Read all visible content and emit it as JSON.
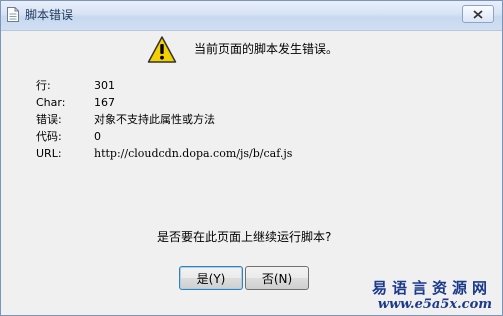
{
  "window": {
    "title": "脚本错误",
    "close_icon": "close-icon"
  },
  "dialog": {
    "icon": "warning-icon",
    "message": "当前页面的脚本发生错误。",
    "details": [
      {
        "key": "行:",
        "value": "301"
      },
      {
        "key": "Char:",
        "value": "167"
      },
      {
        "key": "错误:",
        "value": "对象不支持此属性或方法"
      },
      {
        "key": "代码:",
        "value": "0"
      },
      {
        "key": "URL:",
        "value": "http://cloudcdn.dopa.com/js/b/caf.js"
      }
    ],
    "question": "是否要在此页面上继续运行脚本?",
    "yes_label": "是(Y)",
    "no_label": "否(N)"
  },
  "watermark": {
    "line1": "易语言资源网",
    "line2": "www.e5a5x.com"
  },
  "colors": {
    "title_text": "#1e395b",
    "watermark": "#1b3a8c",
    "warning_fill": "#f5d000"
  }
}
